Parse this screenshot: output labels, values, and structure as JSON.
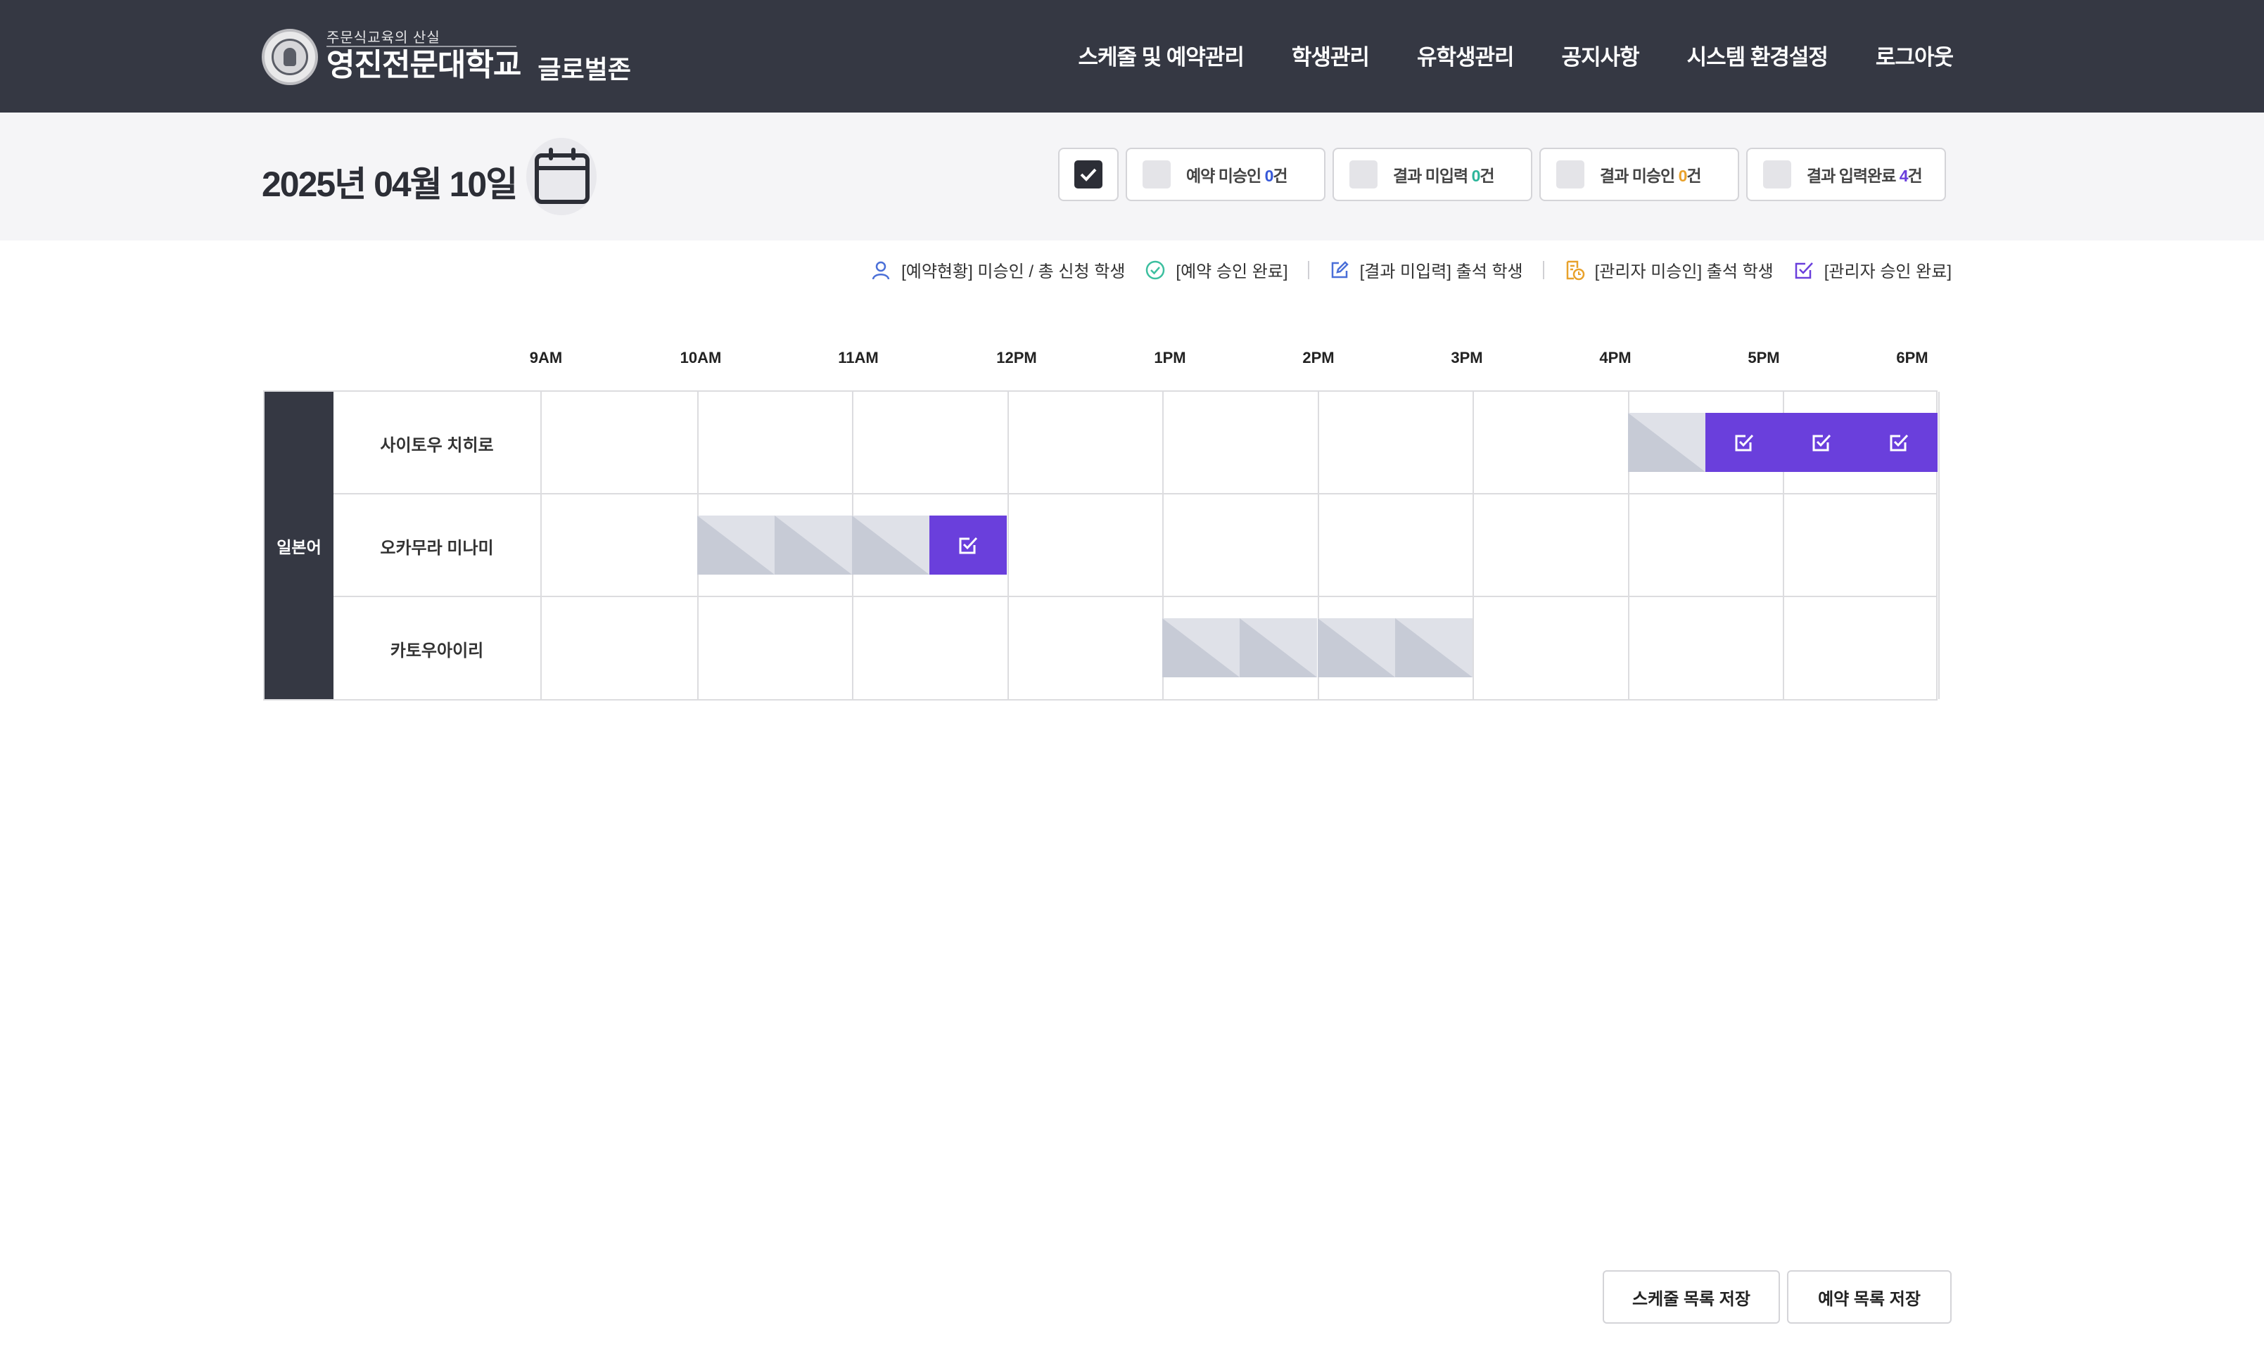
{
  "header": {
    "logo_tagline": "주문식교육의 산실",
    "logo_name": "영진전문대학교",
    "logo_zone": "글로벌존",
    "nav": [
      "스케줄 및 예약관리",
      "학생관리",
      "유학생관리",
      "공지사항",
      "시스템 환경설정",
      "로그아웃"
    ]
  },
  "datebar": {
    "date": "2025년 04월 10일",
    "filters": [
      {
        "label": "예약 미승인 ",
        "count": "0",
        "unit": "건",
        "count_color": "#3658d8"
      },
      {
        "label": "결과 미입력 ",
        "count": "0",
        "unit": "건",
        "count_color": "#2bb59a"
      },
      {
        "label": "결과 미승인 ",
        "count": "0",
        "unit": "건",
        "count_color": "#e8a12b"
      },
      {
        "label": "결과 입력완료 ",
        "count": "4",
        "unit": "건",
        "count_color": "#6a3fdc"
      }
    ]
  },
  "legend": [
    {
      "icon": "person-icon",
      "label": "[예약현황] 미승인 / 총 신청 학생"
    },
    {
      "icon": "check-circle-icon",
      "label": "[예약 승인 완료]"
    },
    {
      "icon": "edit-icon",
      "label": "[결과 미입력] 출석 학생"
    },
    {
      "icon": "document-clock-icon",
      "label": "[관리자 미승인] 출석 학생"
    },
    {
      "icon": "check-square-icon",
      "label": "[관리자 승인 완료]"
    }
  ],
  "schedule": {
    "time_labels": [
      "9AM",
      "10AM",
      "11AM",
      "12PM",
      "1PM",
      "2PM",
      "3PM",
      "4PM",
      "5PM",
      "6PM"
    ],
    "group": "일본어",
    "rows": [
      {
        "name": "사이토우 치히로"
      },
      {
        "name": "오카무라 미나미"
      },
      {
        "name": "카토우아이리"
      }
    ],
    "slots": [
      {
        "row": 0,
        "time": "16:00",
        "status": "pending"
      },
      {
        "row": 0,
        "time": "16:30",
        "status": "approved"
      },
      {
        "row": 0,
        "time": "17:00",
        "status": "approved"
      },
      {
        "row": 0,
        "time": "17:30",
        "status": "approved"
      },
      {
        "row": 1,
        "time": "10:00",
        "status": "pending"
      },
      {
        "row": 1,
        "time": "10:30",
        "status": "pending"
      },
      {
        "row": 1,
        "time": "11:00",
        "status": "pending"
      },
      {
        "row": 1,
        "time": "11:30",
        "status": "approved"
      },
      {
        "row": 2,
        "time": "13:00",
        "status": "pending"
      },
      {
        "row": 2,
        "time": "13:30",
        "status": "pending"
      },
      {
        "row": 2,
        "time": "14:00",
        "status": "pending"
      },
      {
        "row": 2,
        "time": "14:30",
        "status": "pending"
      }
    ]
  },
  "colors": {
    "header_bg": "#353843",
    "approved": "#6a3fdc",
    "pending": "#dfe1e8"
  },
  "buttons": {
    "save_schedule": "스케줄 목록 저장",
    "save_reservation": "예약 목록 저장"
  }
}
